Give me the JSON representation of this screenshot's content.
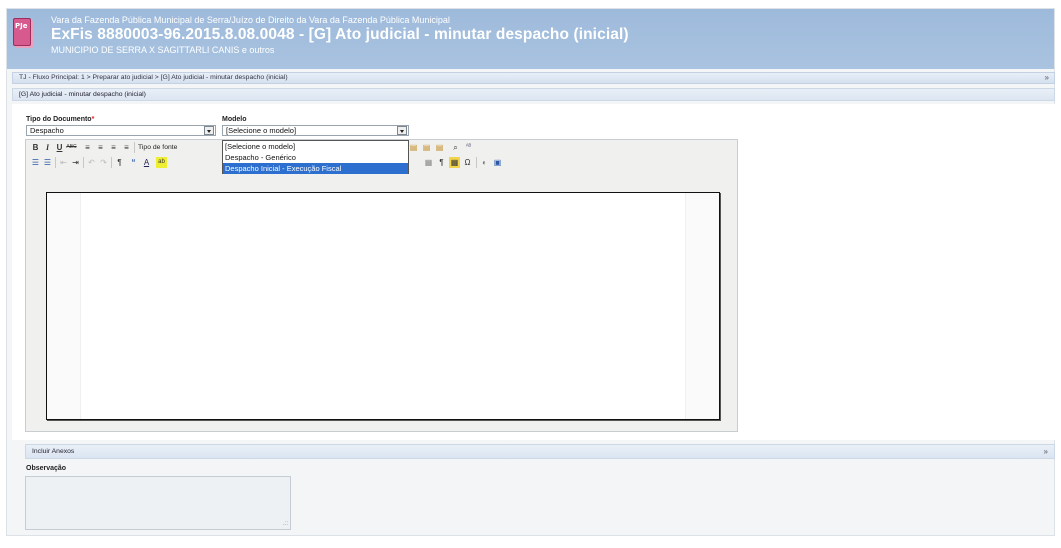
{
  "header": {
    "court": "Vara da Fazenda Pública Municipal de Serra/Juízo de Direito da Vara da Fazenda Pública Municipal",
    "title": "ExFis 8880003-96.2015.8.08.0048 - [G] Ato judicial - minutar despacho (inicial)",
    "parties": "MUNICIPIO DE SERRA X SAGITTARLI CANIS e outros",
    "logo_text": "PJe"
  },
  "breadcrumb": {
    "text": "TJ - Fluxo Principal: 1 > Preparar ato judicial > [G] Ato judicial - minutar despacho (inicial)",
    "toggle": "»"
  },
  "section": {
    "title": "[G] Ato judicial - minutar despacho (inicial)"
  },
  "form": {
    "tipo_label": "Tipo do Documento",
    "required_mark": "*",
    "tipo_value": "Despacho",
    "modelo_label": "Modelo",
    "modelo_value": "[Selecione o modelo]",
    "modelo_options": [
      "[Selecione o modelo]",
      "Despacho - Genérico",
      "Despacho Inicial - Execução Fiscal"
    ],
    "highlighted_option_index": 2
  },
  "toolbar": {
    "font_label": "Tipo de fonte",
    "row1": [
      "B",
      "I",
      "U",
      "ABC",
      "≡",
      "≡",
      "≡",
      "≡"
    ],
    "row2_glyphs": [
      "☰",
      "☰",
      "⇤",
      "⇥",
      "↶",
      "↷",
      "¶",
      "“",
      "A",
      "ab"
    ],
    "row2_right": [
      "▦",
      "¶",
      "▦",
      "Ω",
      "◐",
      "▣"
    ]
  },
  "anexos": {
    "title": "Incluir Anexos",
    "toggle": "»"
  },
  "observacao": {
    "label": "Observação",
    "value": ""
  }
}
